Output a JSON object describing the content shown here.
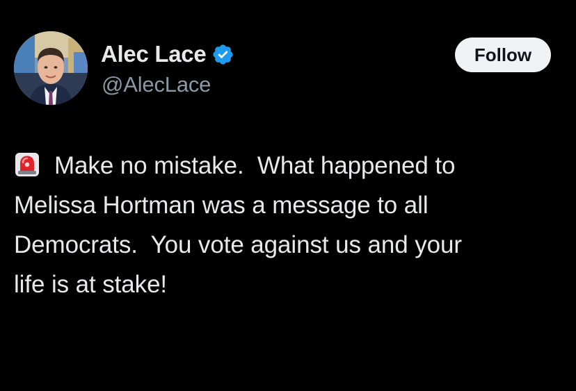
{
  "tweet": {
    "author": {
      "display_name": "Alec Lace",
      "handle": "@AlecLace",
      "verified": true,
      "verified_icon": "verified-badge-icon",
      "avatar": "avatar-photo"
    },
    "follow_button_label": "Follow",
    "body": {
      "lead_icon": "rotating-light-icon",
      "lines": [
        "Make no mistake.  What happened to",
        "Melissa Hortman was a message to all",
        "Democrats.  You vote against us and your",
        "life is at stake!"
      ]
    }
  },
  "colors": {
    "background": "#000000",
    "text_primary": "#e7e9ea",
    "text_secondary": "#8b98a5",
    "verified_blue": "#1d9bf0",
    "button_bg": "#eff3f4",
    "button_text": "#0f1419"
  }
}
